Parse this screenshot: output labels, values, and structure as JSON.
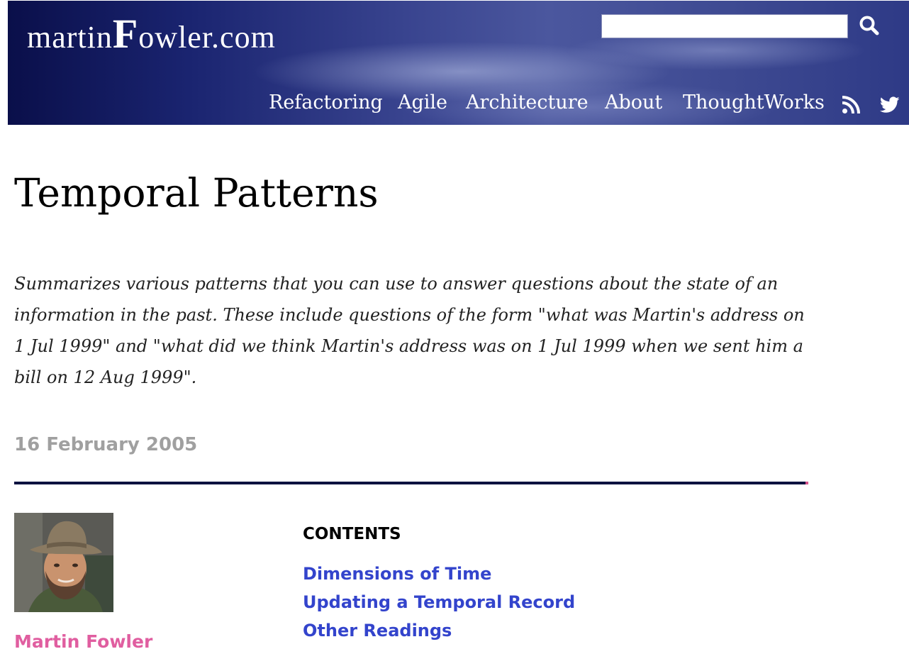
{
  "header": {
    "logo": {
      "prefix": "martin",
      "big_letter": "F",
      "suffix": "owler.com"
    },
    "search": {
      "value": "",
      "placeholder": ""
    },
    "nav": [
      {
        "label": "Refactoring"
      },
      {
        "label": "Agile"
      },
      {
        "label": "Architecture"
      },
      {
        "label": "About"
      },
      {
        "label": "ThoughtWorks"
      }
    ],
    "icons": [
      "search-icon",
      "rss-icon",
      "twitter-icon"
    ]
  },
  "article": {
    "title": "Temporal Patterns",
    "abstract": "Summarizes various patterns that you can use to answer questions about the state of an information in the past. These include questions of the form \"what was Martin's address on 1 Jul 1999\" and \"what did we think Martin's address was on 1 Jul 1999 when we sent him a bill on 12 Aug 1999\".",
    "date": "16 February 2005",
    "author": "Martin Fowler",
    "contents_heading": "CONTENTS",
    "toc": [
      {
        "label": "Dimensions of Time"
      },
      {
        "label": "Updating a Temporal Record"
      },
      {
        "label": "Other Readings"
      }
    ]
  },
  "colors": {
    "header_dark": "#0a0f4a",
    "divider": "#0c1240",
    "author_pink": "#e05ea0",
    "link_blue": "#3344cc",
    "date_gray": "#a0a0a0"
  }
}
